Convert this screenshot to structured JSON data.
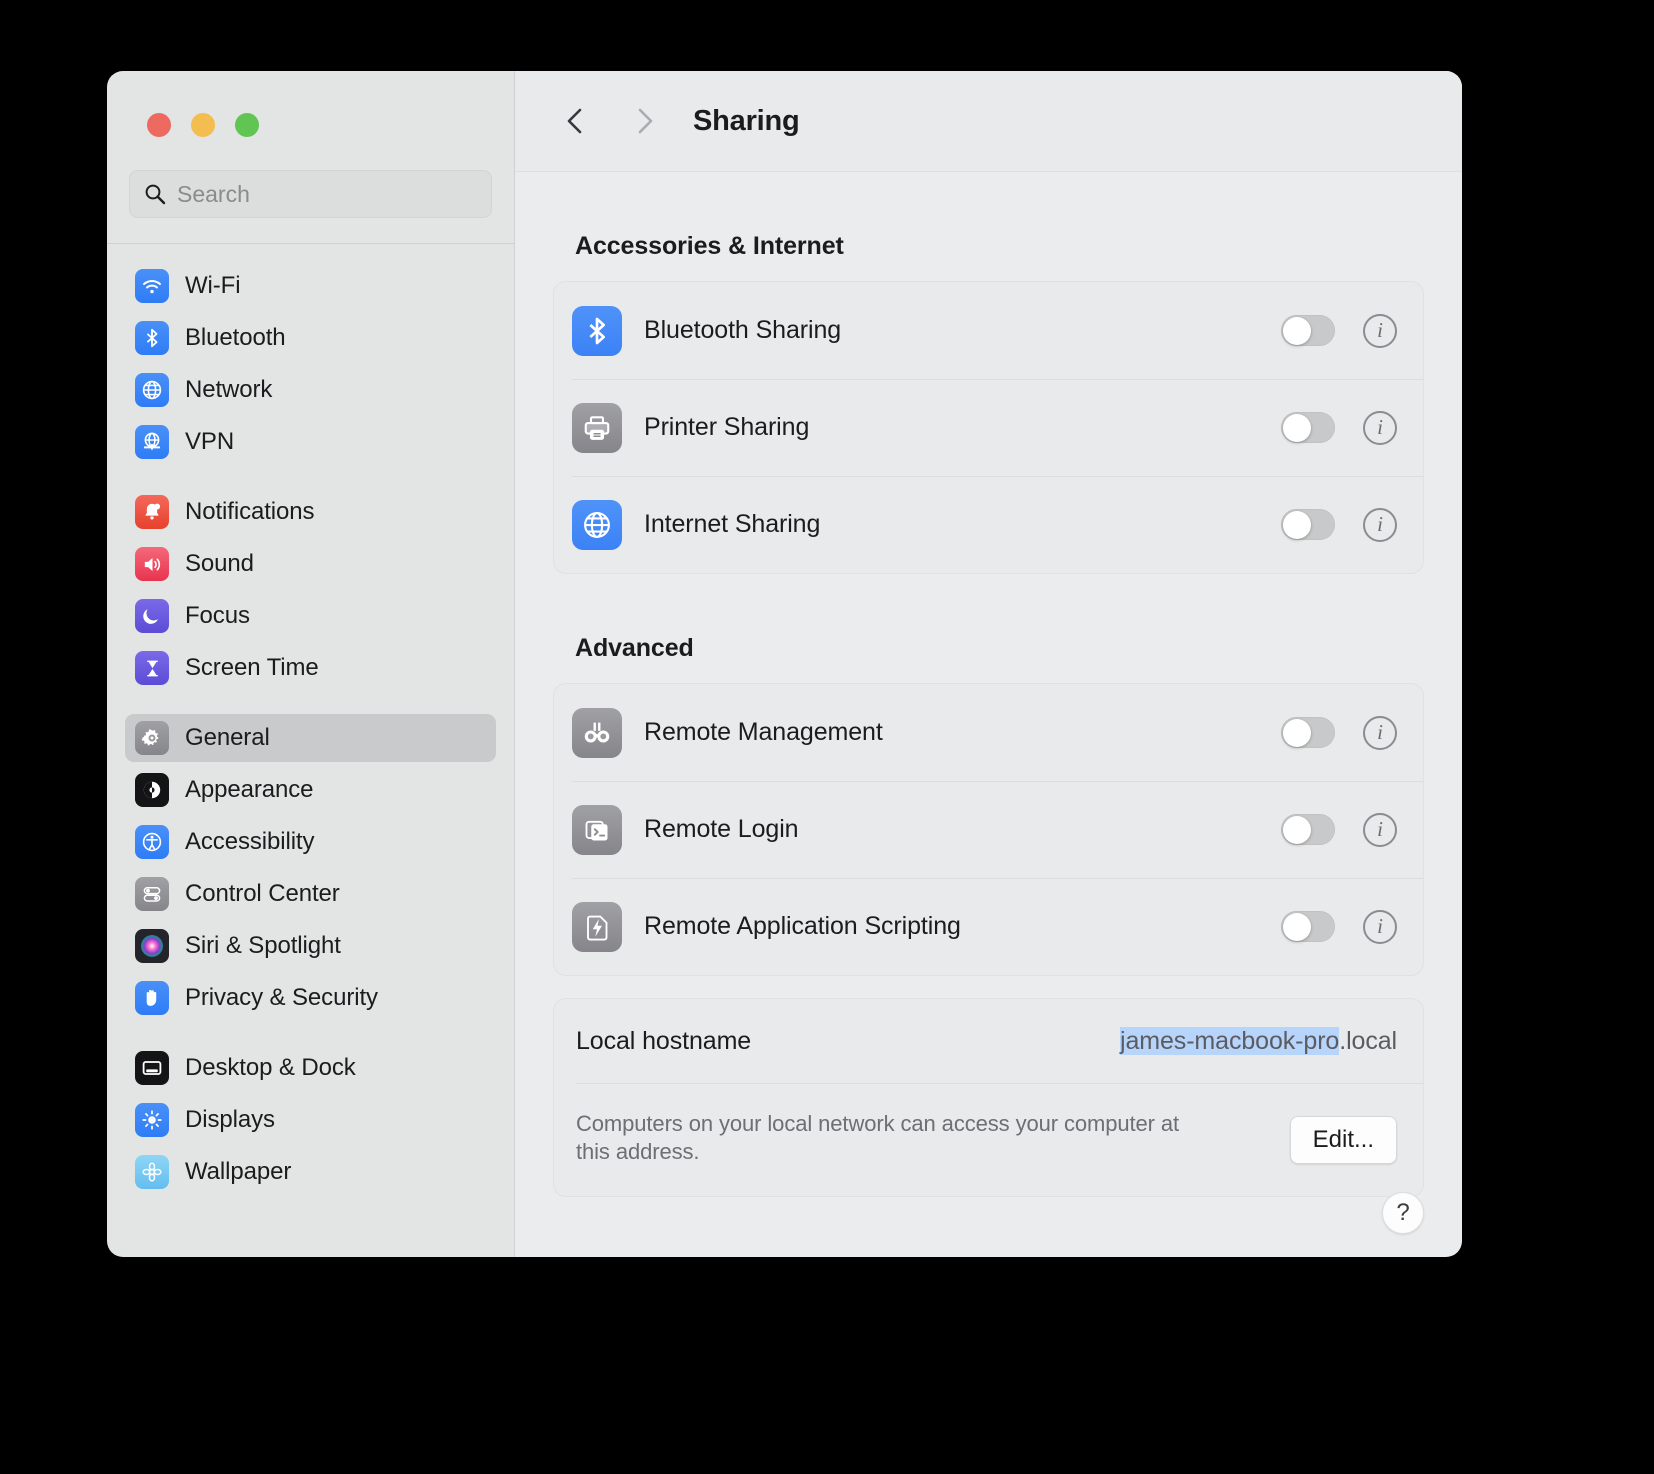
{
  "window": {
    "traffic_lights": [
      {
        "name": "close",
        "color": "#ec6a5f"
      },
      {
        "name": "minimize",
        "color": "#f4bd4f"
      },
      {
        "name": "zoom",
        "color": "#61c554"
      }
    ]
  },
  "sidebar": {
    "search": {
      "placeholder": "Search",
      "value": "",
      "icon": "search-icon"
    },
    "groups": [
      {
        "items": [
          {
            "label": "Wi-Fi",
            "icon": "wifi-icon",
            "color": "#2e7cf6",
            "selected": false
          },
          {
            "label": "Bluetooth",
            "icon": "bluetooth-icon",
            "color": "#2e7cf6",
            "selected": false
          },
          {
            "label": "Network",
            "icon": "globe-icon",
            "color": "#2e7cf6",
            "selected": false
          },
          {
            "label": "VPN",
            "icon": "vpn-globe-icon",
            "color": "#2e7cf6",
            "selected": false
          }
        ]
      },
      {
        "items": [
          {
            "label": "Notifications",
            "icon": "bell-icon",
            "color": "#f0543a",
            "selected": false
          },
          {
            "label": "Sound",
            "icon": "speaker-icon",
            "color": "#ef4f62",
            "selected": false
          },
          {
            "label": "Focus",
            "icon": "moon-icon",
            "color": "#6a5ce0",
            "selected": false
          },
          {
            "label": "Screen Time",
            "icon": "hourglass-icon",
            "color": "#6a5ce0",
            "selected": false
          }
        ]
      },
      {
        "items": [
          {
            "label": "General",
            "icon": "gear-icon",
            "color": "#8e8e93",
            "selected": true
          },
          {
            "label": "Appearance",
            "icon": "appearance-icon",
            "color": "#1c1c1e",
            "selected": false
          },
          {
            "label": "Accessibility",
            "icon": "accessibility-icon",
            "color": "#2e7cf6",
            "selected": false
          },
          {
            "label": "Control Center",
            "icon": "switches-icon",
            "color": "#8e8e93",
            "selected": false
          },
          {
            "label": "Siri & Spotlight",
            "icon": "siri-icon",
            "color": "#2b2b35",
            "selected": false
          },
          {
            "label": "Privacy & Security",
            "icon": "hand-icon",
            "color": "#2e7cf6",
            "selected": false
          }
        ]
      },
      {
        "items": [
          {
            "label": "Desktop & Dock",
            "icon": "desktop-dock-icon",
            "color": "#1c1c1e",
            "selected": false
          },
          {
            "label": "Displays",
            "icon": "brightness-icon",
            "color": "#2e7cf6",
            "selected": false
          },
          {
            "label": "Wallpaper",
            "icon": "wallpaper-icon",
            "color": "#74c8f2",
            "selected": false
          }
        ]
      }
    ]
  },
  "header": {
    "title": "Sharing",
    "back_icon": "chevron-left-icon",
    "forward_icon": "chevron-right-icon",
    "back_enabled": true,
    "forward_enabled": false
  },
  "main": {
    "sections": [
      {
        "title": "Accessories & Internet",
        "rows": [
          {
            "label": "Bluetooth Sharing",
            "icon": "bluetooth-icon",
            "color": "#3b82f6",
            "toggle": "off",
            "info": "i"
          },
          {
            "label": "Printer Sharing",
            "icon": "printer-icon",
            "color": "#8e8e93",
            "toggle": "off",
            "info": "i"
          },
          {
            "label": "Internet Sharing",
            "icon": "globe-icon",
            "color": "#3b82f6",
            "toggle": "off",
            "info": "i"
          }
        ]
      },
      {
        "title": "Advanced",
        "rows": [
          {
            "label": "Remote Management",
            "icon": "binoculars-icon",
            "color": "#8e8e93",
            "toggle": "off",
            "info": "i"
          },
          {
            "label": "Remote Login",
            "icon": "terminal-icon",
            "color": "#8e8e93",
            "toggle": "off",
            "info": "i"
          },
          {
            "label": "Remote Application Scripting",
            "icon": "script-bolt-icon",
            "color": "#8e8e93",
            "toggle": "off",
            "info": "i"
          }
        ]
      }
    ],
    "hostname": {
      "label": "Local hostname",
      "value_selected": "james-macbook-pro",
      "value_suffix": ".local",
      "selection_color": "#b7d4fb",
      "description": "Computers on your local network can access your computer at this address.",
      "edit_label": "Edit..."
    },
    "help_label": "?"
  }
}
